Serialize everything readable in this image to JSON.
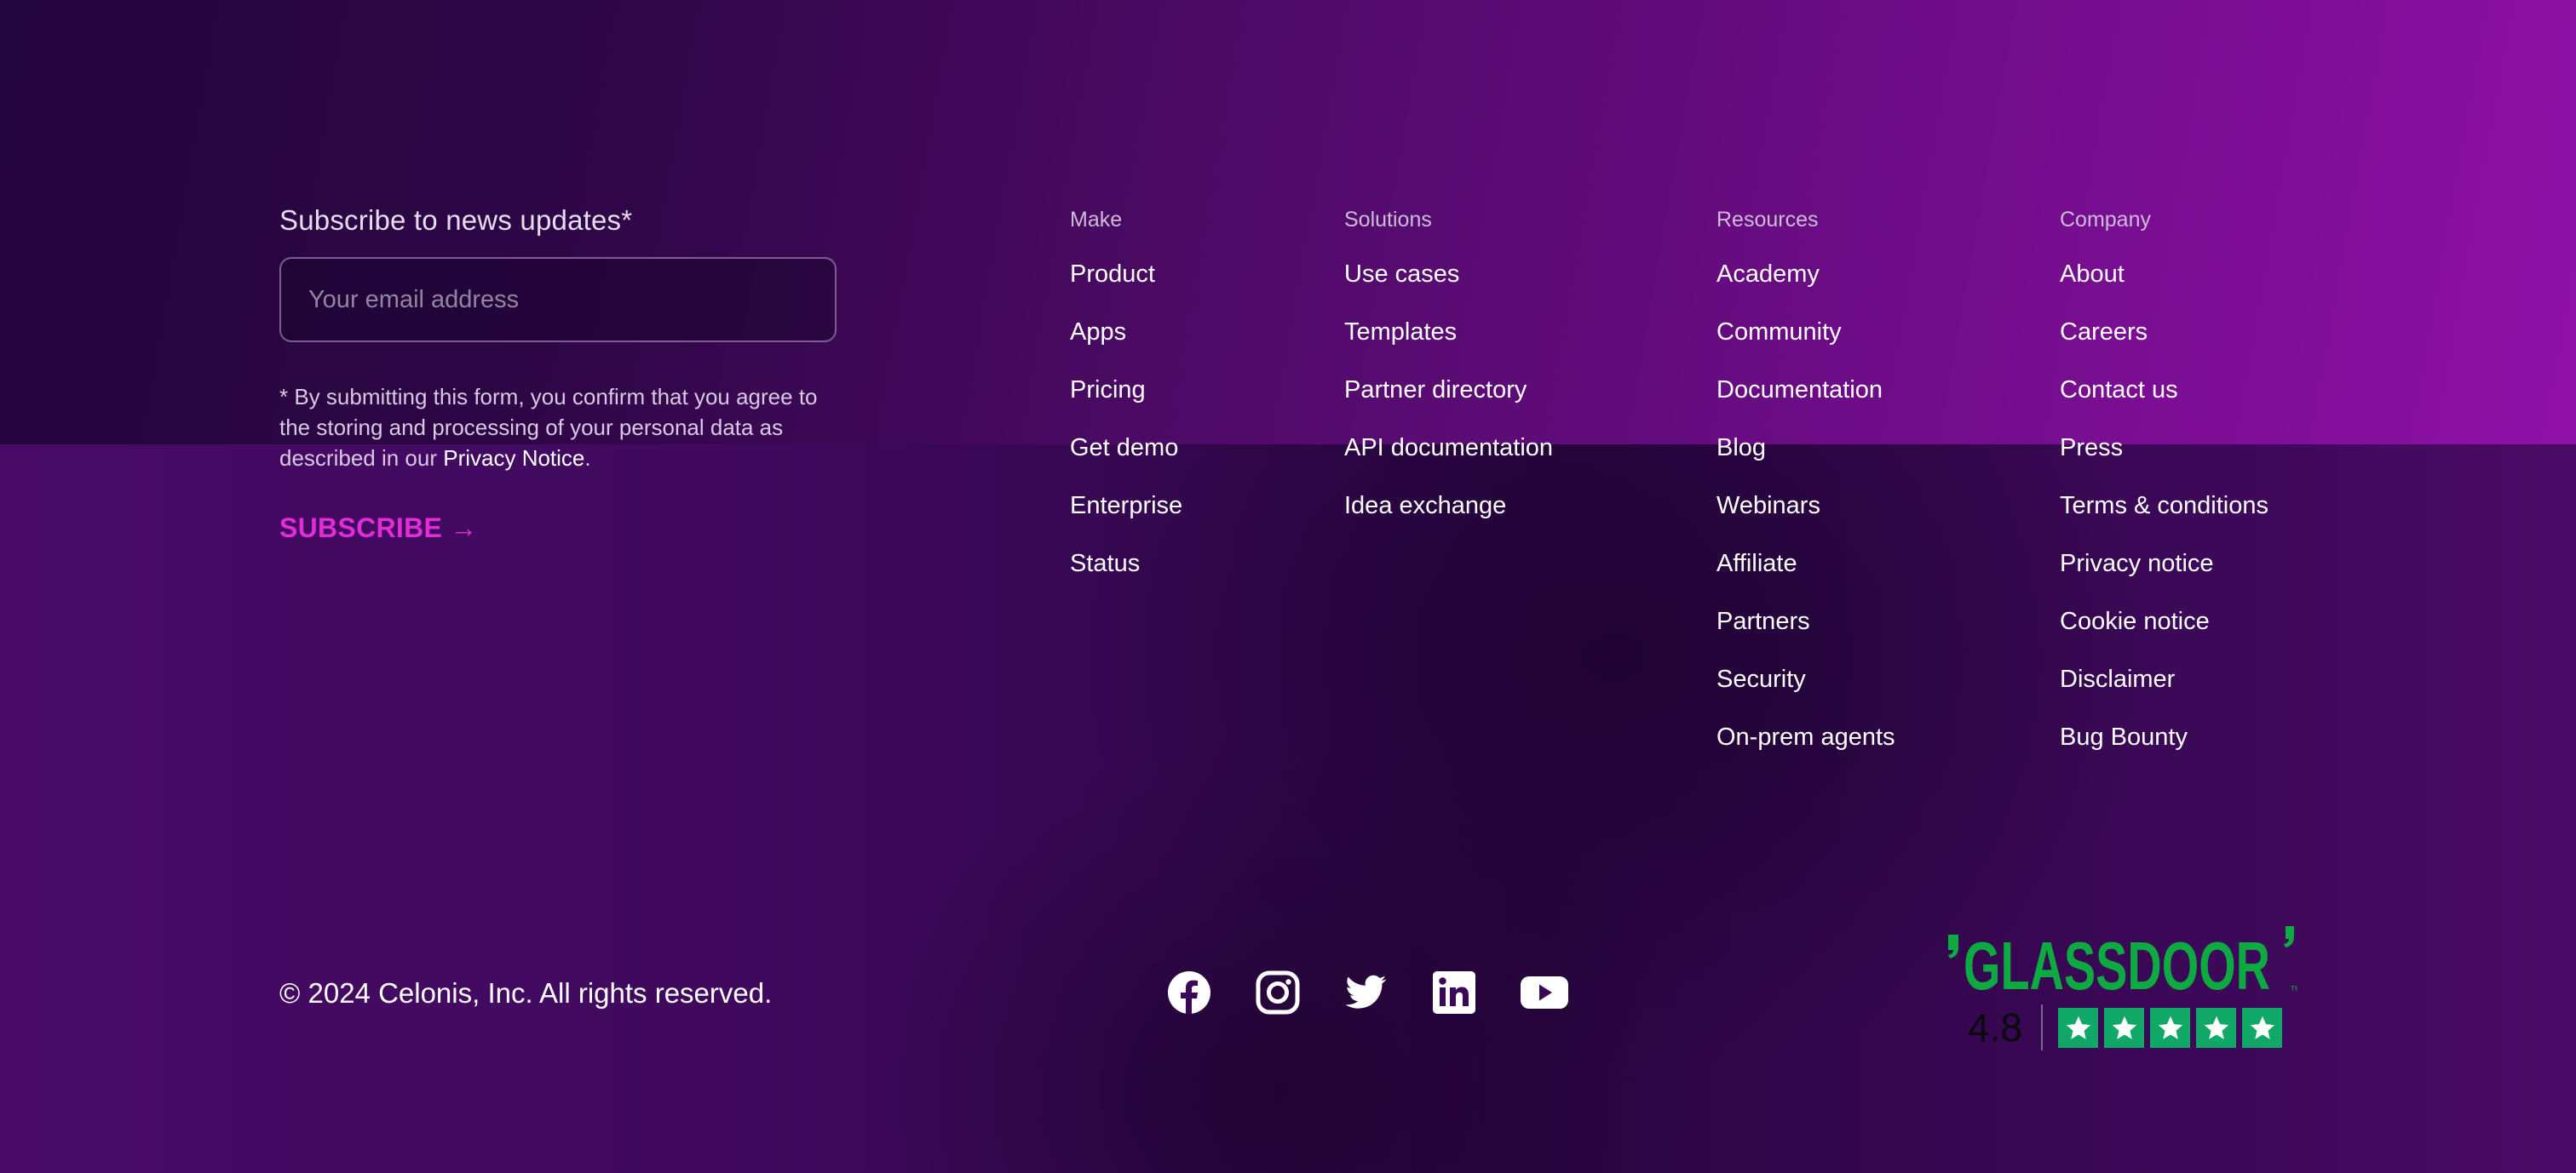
{
  "newsletter": {
    "title": "Subscribe to news updates*",
    "email_placeholder": "Your email address",
    "email_value": "",
    "disclaimer_text": "* By submitting this form, you confirm that you agree to the storing and processing of your personal data as described in our ",
    "privacy_link": "Privacy Notice",
    "disclaimer_end": ".",
    "subscribe_label": "SUBSCRIBE →"
  },
  "columns": {
    "make": {
      "heading": "Make",
      "items": [
        "Product",
        "Apps",
        "Pricing",
        "Get demo",
        "Enterprise",
        "Status"
      ]
    },
    "solutions": {
      "heading": "Solutions",
      "items": [
        "Use cases",
        "Templates",
        "Partner directory",
        "API documentation",
        "Idea exchange"
      ]
    },
    "resources": {
      "heading": "Resources",
      "items": [
        "Academy",
        "Community",
        "Documentation",
        "Blog",
        "Webinars",
        "Affiliate",
        "Partners",
        "Security",
        "On-prem agents"
      ]
    },
    "company": {
      "heading": "Company",
      "items": [
        "About",
        "Careers",
        "Contact us",
        "Press",
        "Terms & conditions",
        "Privacy notice",
        "Cookie notice",
        "Disclaimer",
        "Bug Bounty"
      ]
    }
  },
  "footer": {
    "copyright": "© 2024 Celonis, Inc. All rights reserved.",
    "social_icons": [
      "facebook-icon",
      "instagram-icon",
      "twitter-icon",
      "linkedin-icon",
      "youtube-icon"
    ]
  },
  "glassdoor": {
    "logo_text": "GLASSDOOR",
    "rating": "4.8",
    "stars": 5,
    "brand_color": "#0caa41"
  },
  "colors": {
    "accent": "#e12cd7",
    "background_dark": "#24063e",
    "background_light": "#8f10a6"
  }
}
